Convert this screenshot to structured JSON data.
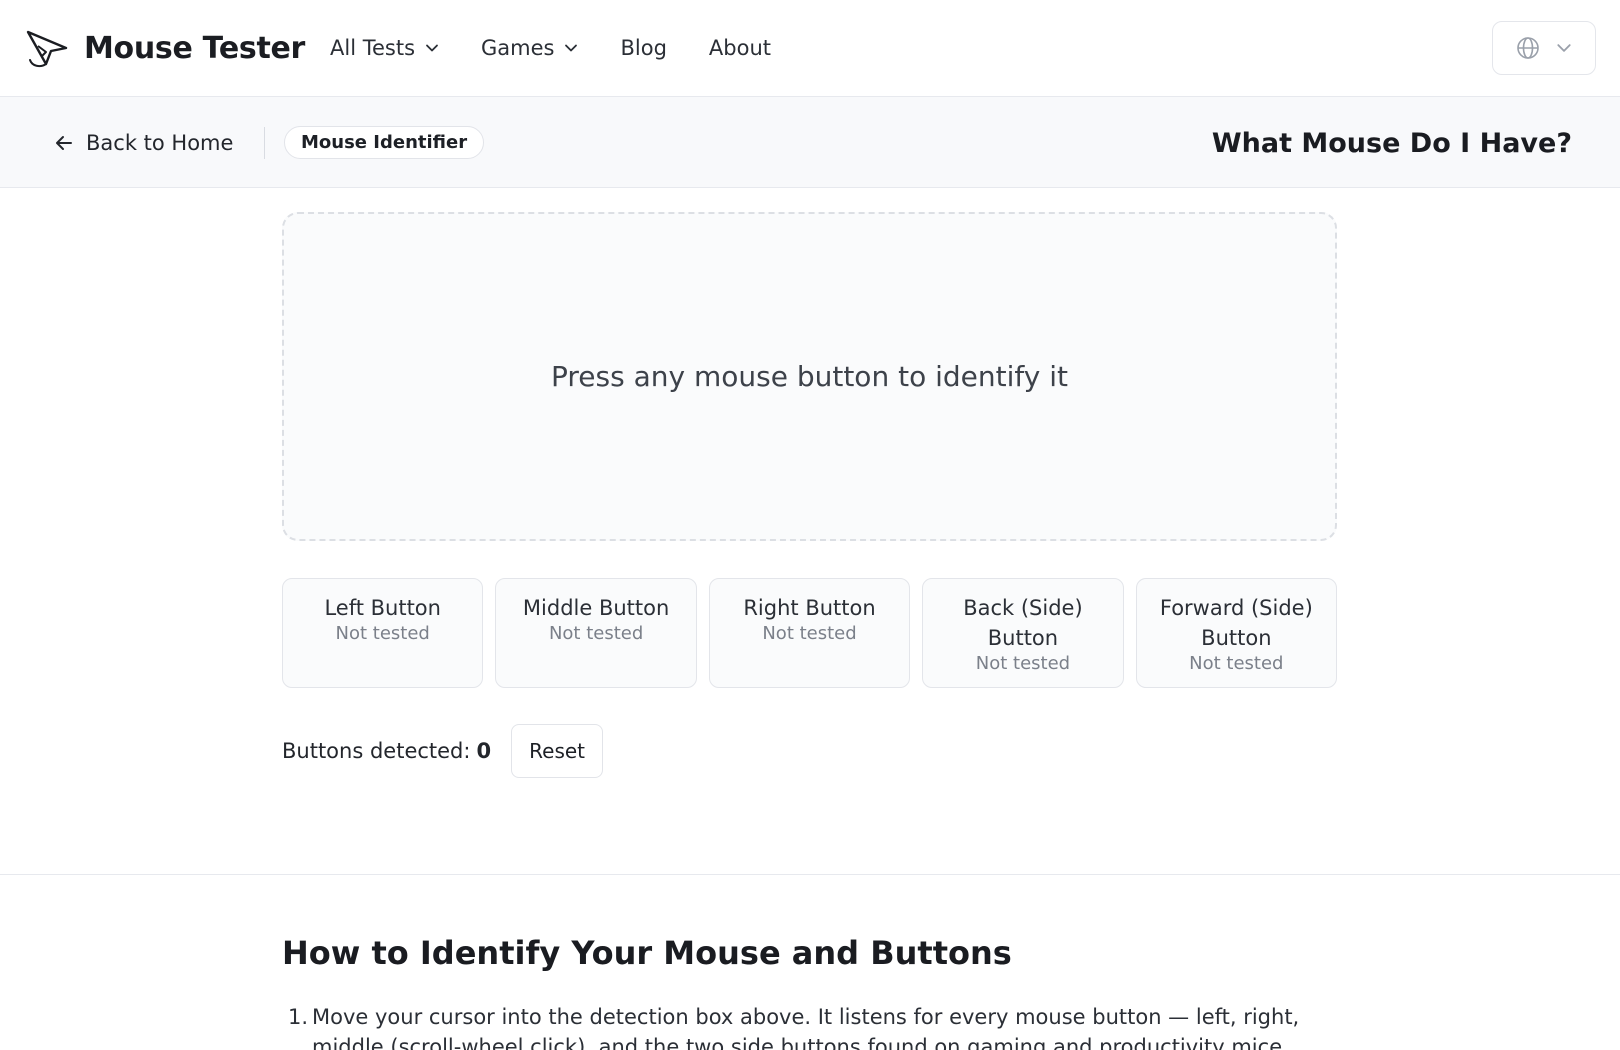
{
  "brand": {
    "name": "Mouse Tester"
  },
  "nav": {
    "items": [
      {
        "label": "All Tests",
        "has_dropdown": true
      },
      {
        "label": "Games",
        "has_dropdown": true
      },
      {
        "label": "Blog",
        "has_dropdown": false
      },
      {
        "label": "About",
        "has_dropdown": false
      }
    ],
    "language_icon": "globe-icon"
  },
  "subheader": {
    "back_label": "Back to Home",
    "breadcrumb": "Mouse Identifier",
    "title": "What Mouse Do I Have?"
  },
  "detector": {
    "prompt": "Press any mouse button to identify it"
  },
  "buttons": [
    {
      "label": "Left Button",
      "status": "Not tested"
    },
    {
      "label": "Middle Button",
      "status": "Not tested"
    },
    {
      "label": "Right Button",
      "status": "Not tested"
    },
    {
      "label": "Back (Side) Button",
      "status": "Not tested"
    },
    {
      "label": "Forward (Side) Button",
      "status": "Not tested"
    }
  ],
  "summary": {
    "detected_label": "Buttons detected:",
    "detected_count": "0",
    "reset_label": "Reset"
  },
  "howto": {
    "title": "How to Identify Your Mouse and Buttons",
    "steps": [
      {
        "num": "1.",
        "text": "Move your cursor into the detection box above. It listens for every mouse button — left, right, middle (scroll-wheel click), and the two side buttons found on gaming and productivity mice."
      }
    ]
  },
  "colors": {
    "text": "#1f2228",
    "muted": "#7b808a",
    "border": "#e3e5ea",
    "subheader_bg": "#f8f9fb"
  }
}
